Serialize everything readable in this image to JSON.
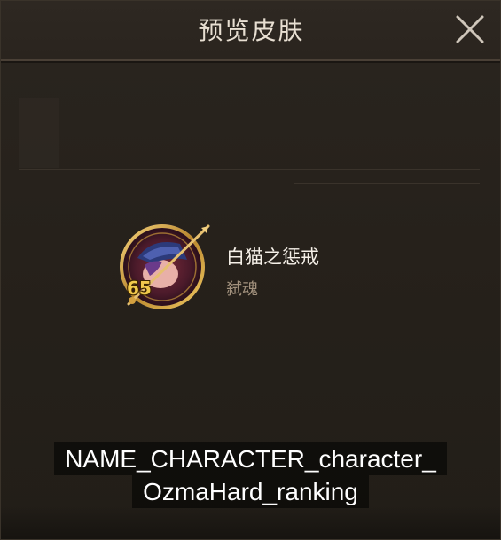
{
  "dialog": {
    "title": "预览皮肤",
    "close_icon": "close-x-icon"
  },
  "skin": {
    "name": "白猫之惩戒",
    "class": "弑魂",
    "level": "65",
    "portrait_icon": "character-portrait"
  },
  "caption": {
    "line1": "NAME_CHARACTER_character_",
    "line2": "OzmaHard_ranking"
  },
  "colors": {
    "title_text": "#e8dfd2",
    "skin_name": "#f5f0e8",
    "skin_class": "#a2917d",
    "level_text": "#f2c94c",
    "panel_bg": "#26211b"
  }
}
